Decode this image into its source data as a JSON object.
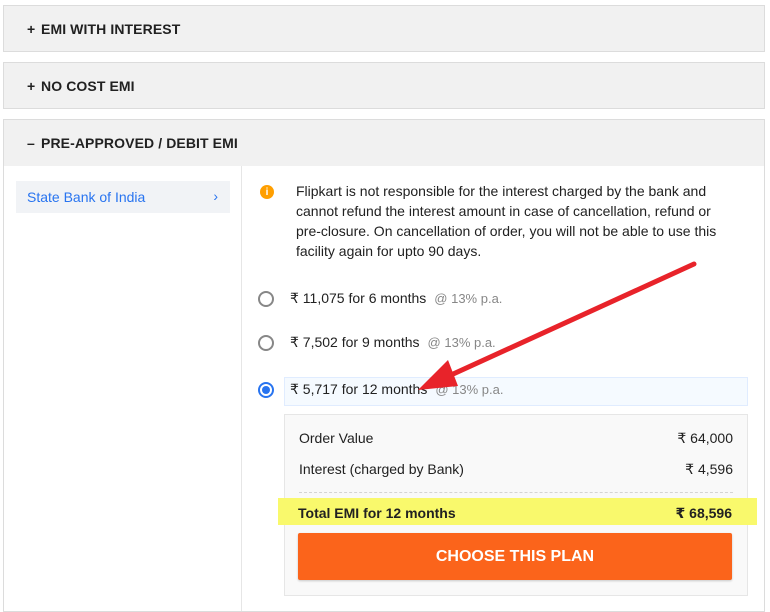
{
  "accordions": [
    {
      "sign": "+",
      "label": "EMI WITH INTEREST"
    },
    {
      "sign": "+",
      "label": "NO COST EMI"
    },
    {
      "sign": "–",
      "label": "PRE-APPROVED / DEBIT EMI"
    }
  ],
  "bank": {
    "name": "State Bank of India",
    "chevron": "›"
  },
  "notice": {
    "icon": "i",
    "text": "Flipkart is not responsible for the interest charged by the bank and cannot refund the interest amount in case of cancellation, refund or pre-closure. On cancellation of order, you will not be able to use this facility again for upto 90 days."
  },
  "plans": [
    {
      "label": "₹ 11,075 for 6 months",
      "rate": "@ 13% p.a.",
      "selected": false
    },
    {
      "label": "₹ 7,502 for 9 months",
      "rate": "@ 13% p.a.",
      "selected": false
    },
    {
      "label": "₹ 5,717 for 12 months",
      "rate": "@ 13% p.a.",
      "selected": true
    }
  ],
  "summary": {
    "order_value_label": "Order Value",
    "order_value": "₹ 64,000",
    "interest_label": "Interest (charged by Bank)",
    "interest": "₹ 4,596",
    "total_label": "Total EMI for 12 months",
    "total": "₹ 68,596"
  },
  "cta": {
    "label": "CHOOSE THIS PLAN"
  },
  "colors": {
    "accent": "#2874f0",
    "cta": "#fb641b",
    "highlight": "#f9f96c",
    "annotation": "#e8232a",
    "info": "#ff9f00"
  }
}
